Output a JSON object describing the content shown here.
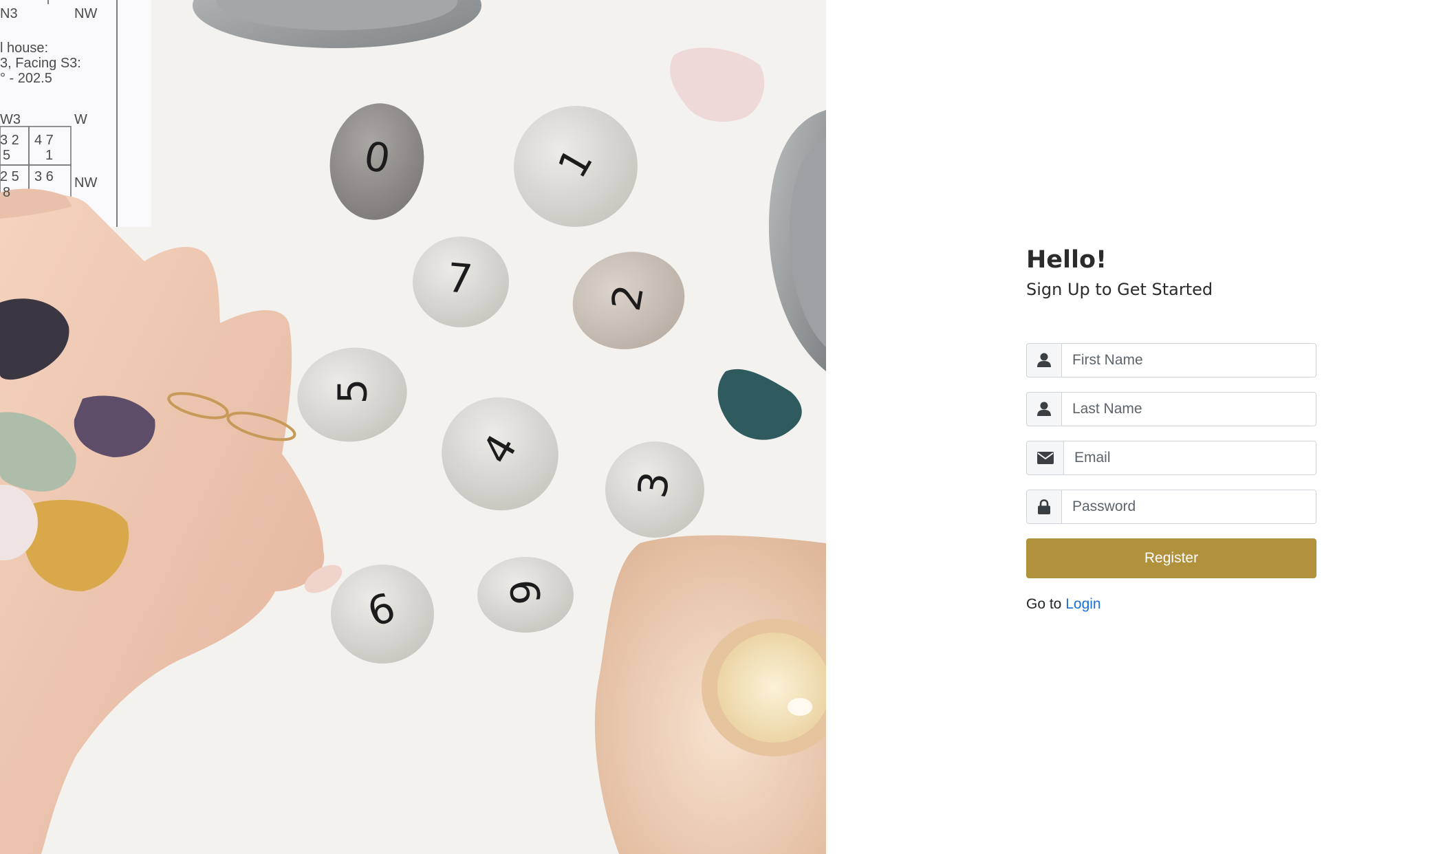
{
  "hero": {
    "paper_text": {
      "n3": "N3",
      "nw_top": "NW",
      "house": "l house:",
      "facing": "3, Facing S3:",
      "degrees": "° -  202.5",
      "w3": "W3",
      "w": "W",
      "g1": "3  2",
      "g2": "5",
      "g3": "4  7",
      "g4": "1",
      "g5": "2  5",
      "g6": "8",
      "g7": "3  6",
      "nw_bottom": "NW"
    },
    "stones": [
      "0",
      "1",
      "7",
      "2",
      "5",
      "4",
      "3",
      "6",
      "9"
    ]
  },
  "form": {
    "greeting": "Hello!",
    "subtitle": "Sign Up to Get Started",
    "fields": {
      "first_name_placeholder": "First Name",
      "last_name_placeholder": "Last Name",
      "email_placeholder": "Email",
      "password_placeholder": "Password"
    },
    "register_label": "Register",
    "login_prefix": "Go to",
    "login_link": "Login"
  },
  "colors": {
    "accent": "#b2913c",
    "link": "#1a6fd8"
  },
  "icons": {
    "first_name": "user-icon",
    "last_name": "user-icon",
    "email": "envelope-icon",
    "password": "lock-icon"
  }
}
